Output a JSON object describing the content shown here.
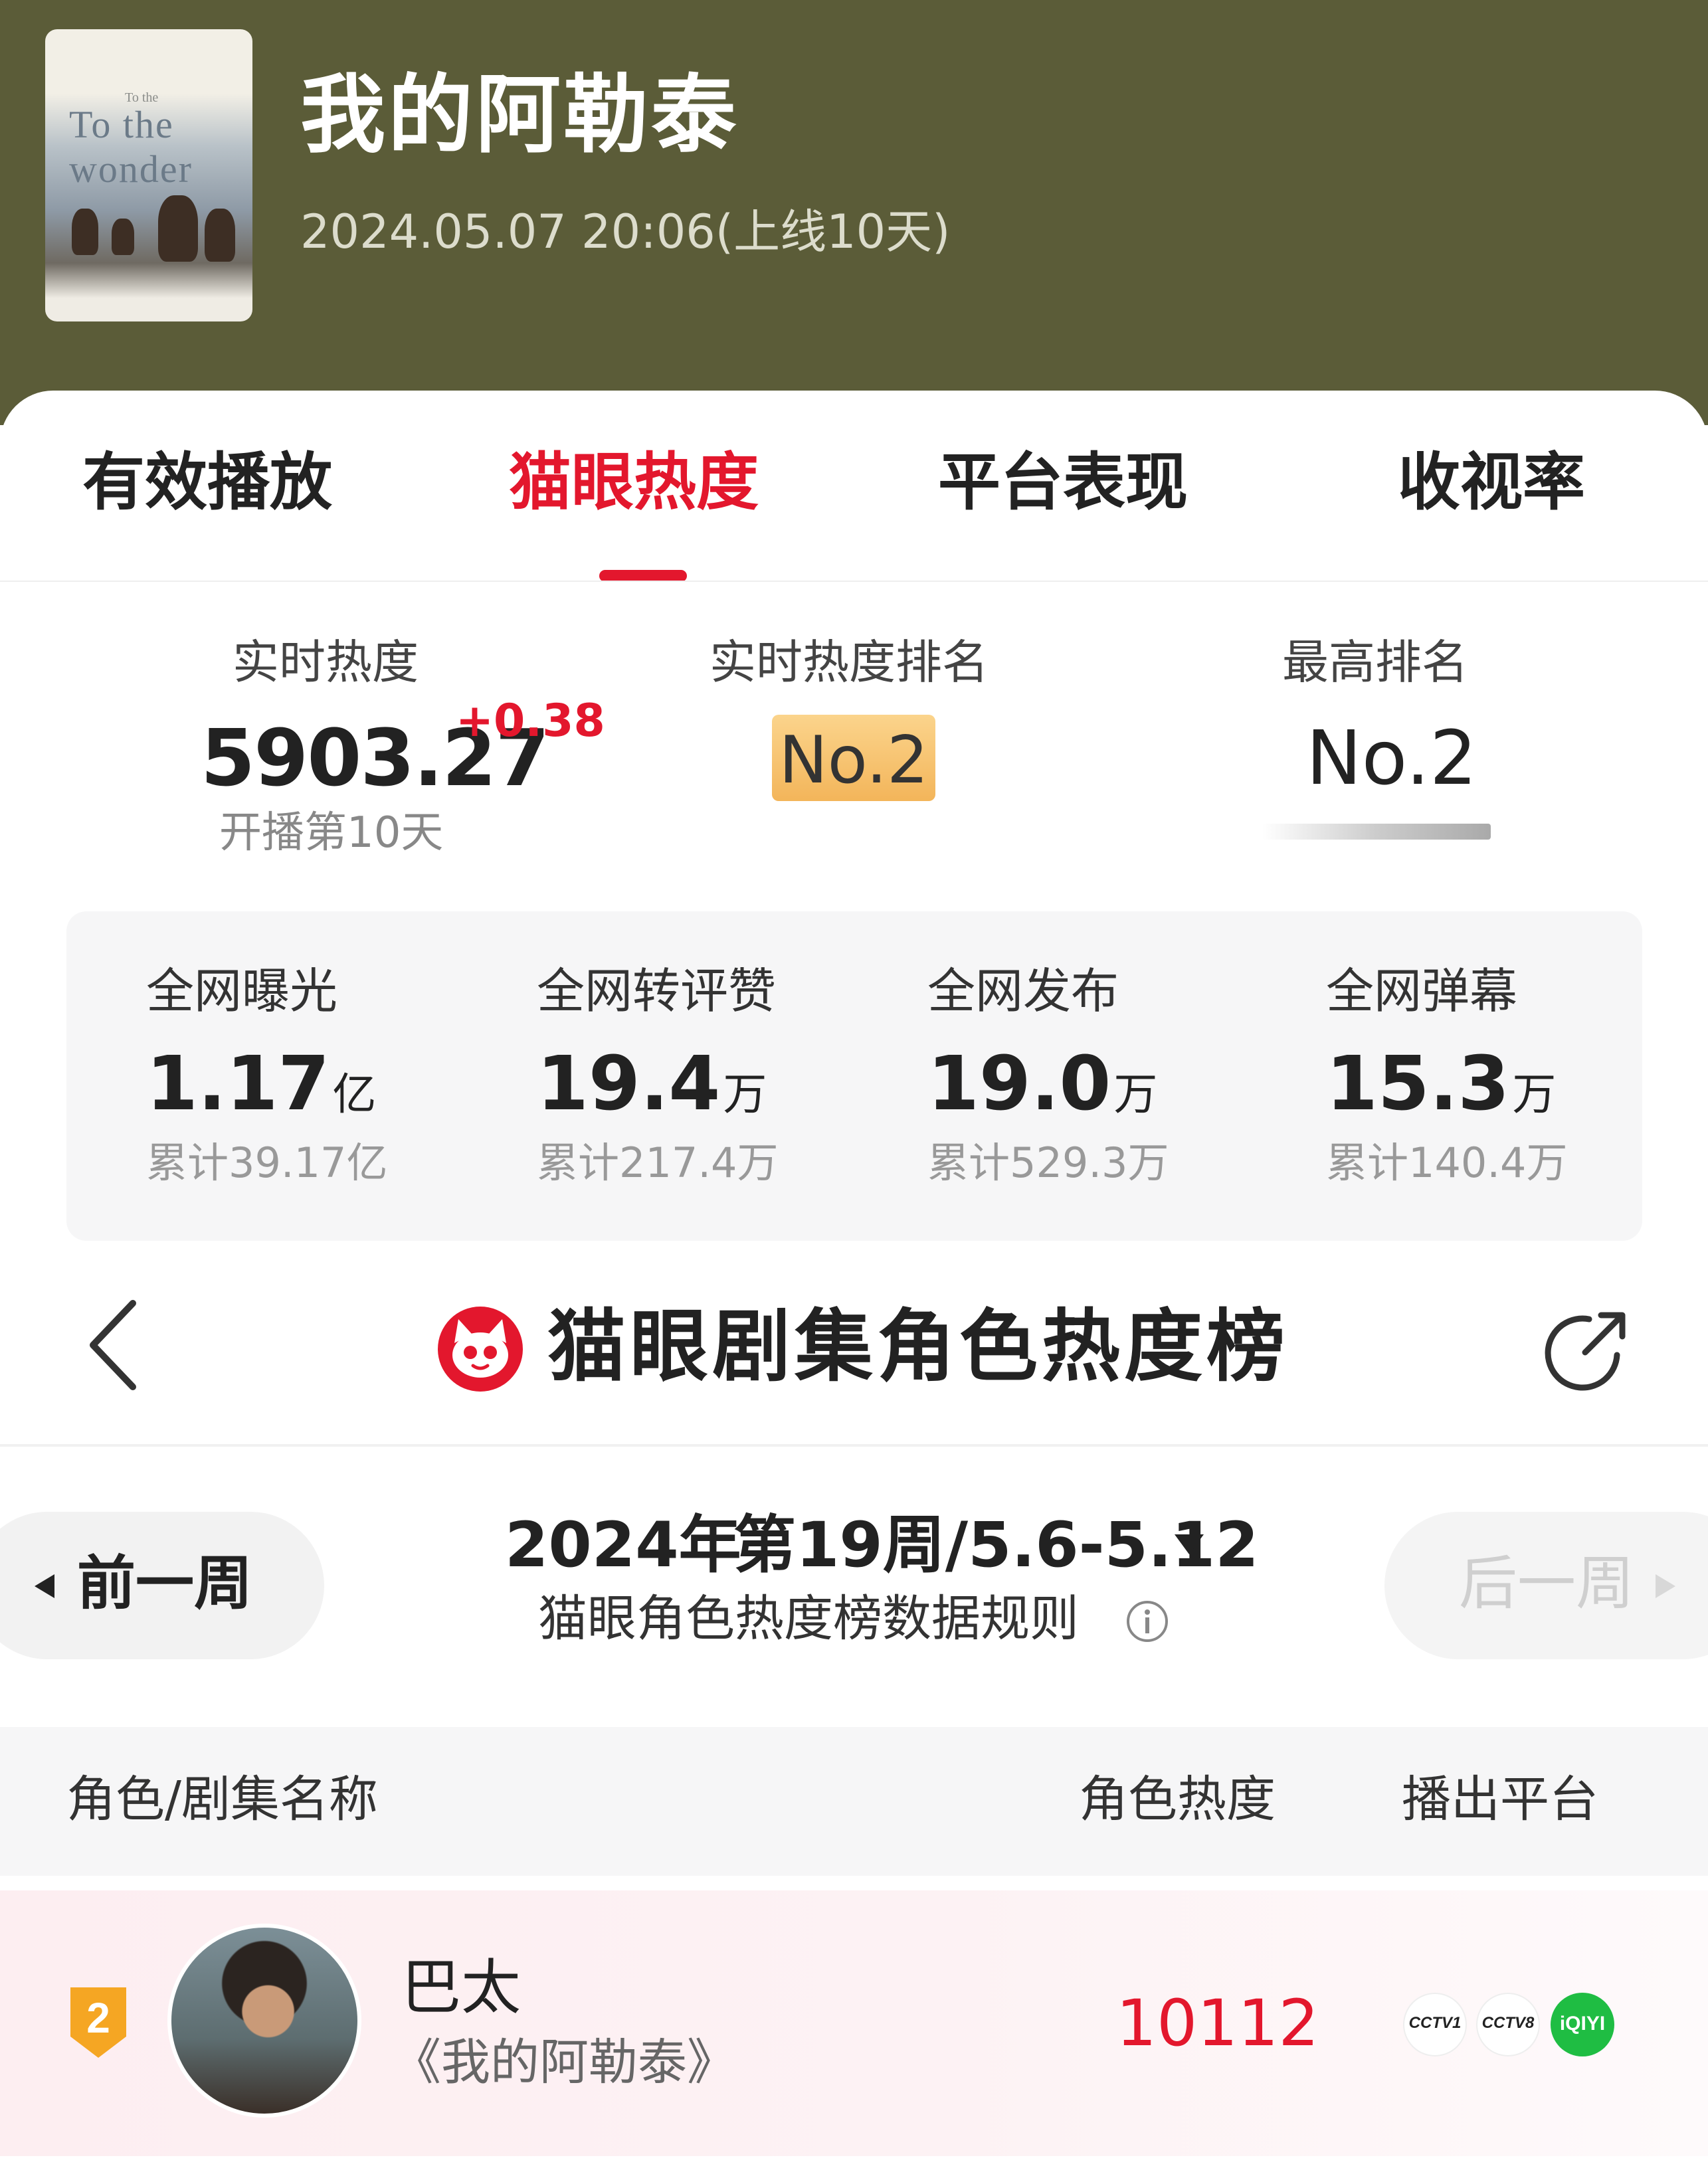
{
  "show": {
    "title": "我的阿勒泰",
    "release": "2024.05.07 20:06(上线10天)",
    "poster_text": "To the wonder",
    "poster_small": "To the"
  },
  "tabs": [
    {
      "label": "有效播放",
      "active": false
    },
    {
      "label": "猫眼热度",
      "active": true
    },
    {
      "label": "平台表现",
      "active": false
    },
    {
      "label": "收视率",
      "active": false
    }
  ],
  "stats": {
    "realtime_heat_label": "实时热度",
    "realtime_heat_value": "5903.27",
    "realtime_heat_delta": "+0.38",
    "realtime_heat_sub": "开播第10天",
    "realtime_rank_label": "实时热度排名",
    "realtime_rank_value": "No.2",
    "best_rank_label": "最高排名",
    "best_rank_value": "No.2"
  },
  "network": [
    {
      "label": "全网曝光",
      "value": "1.17",
      "unit": "亿",
      "cumulative": "累计39.17亿"
    },
    {
      "label": "全网转评赞",
      "value": "19.4",
      "unit": "万",
      "cumulative": "累计217.4万"
    },
    {
      "label": "全网发布",
      "value": "19.0",
      "unit": "万",
      "cumulative": "累计529.3万"
    },
    {
      "label": "全网弹幕",
      "value": "15.3",
      "unit": "万",
      "cumulative": "累计140.4万"
    }
  ],
  "chart": {
    "title": "猫眼剧集角色热度榜",
    "prev_week": "前一周",
    "next_week": "后一周",
    "year": "2024年",
    "week_range": "第19周/5.6-5.12",
    "rules": "猫眼角色热度榜数据规则"
  },
  "table": {
    "col_name": "角色/剧集名称",
    "col_heat": "角色热度",
    "col_platform": "播出平台",
    "rows": [
      {
        "rank": "2",
        "role": "巴太",
        "series": "《我的阿勒泰》",
        "heat": "10112",
        "platforms": [
          "CCTV1",
          "CCTV8",
          "iQIYI"
        ]
      }
    ]
  },
  "colors": {
    "header_bg": "#5b5c38",
    "accent_red": "#e3172d",
    "rank_badge": "#f3b55a",
    "iqiyi_green": "#1fbd43"
  },
  "icons": [
    "back-chevron-icon",
    "maoyan-cat-logo-icon",
    "share-icon",
    "info-icon",
    "caret-down-icon",
    "rank-shield-icon"
  ]
}
